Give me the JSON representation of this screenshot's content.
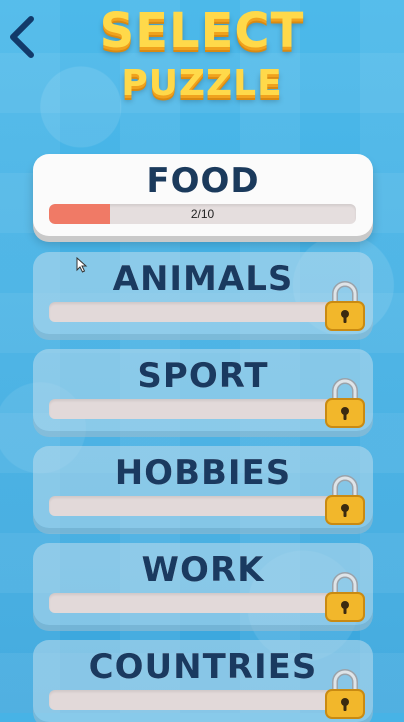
{
  "title": {
    "line1": "SELECT",
    "line2": "PUZZLE"
  },
  "back_icon": "chevron-left-icon",
  "categories": [
    {
      "name": "FOOD",
      "locked": false,
      "progress_text": "2/10",
      "progress": 0.2
    },
    {
      "name": "ANIMALS",
      "locked": true
    },
    {
      "name": "SPORT",
      "locked": true
    },
    {
      "name": "HOBBIES",
      "locked": true
    },
    {
      "name": "WORK",
      "locked": true
    },
    {
      "name": "COUNTRIES",
      "locked": true
    }
  ],
  "colors": {
    "background": "#47b3e6",
    "title_yellow": "#ffd94a",
    "label_navy": "#1b3a5c",
    "progress_fill": "#f07a66",
    "lock_gold": "#f2b72b"
  }
}
